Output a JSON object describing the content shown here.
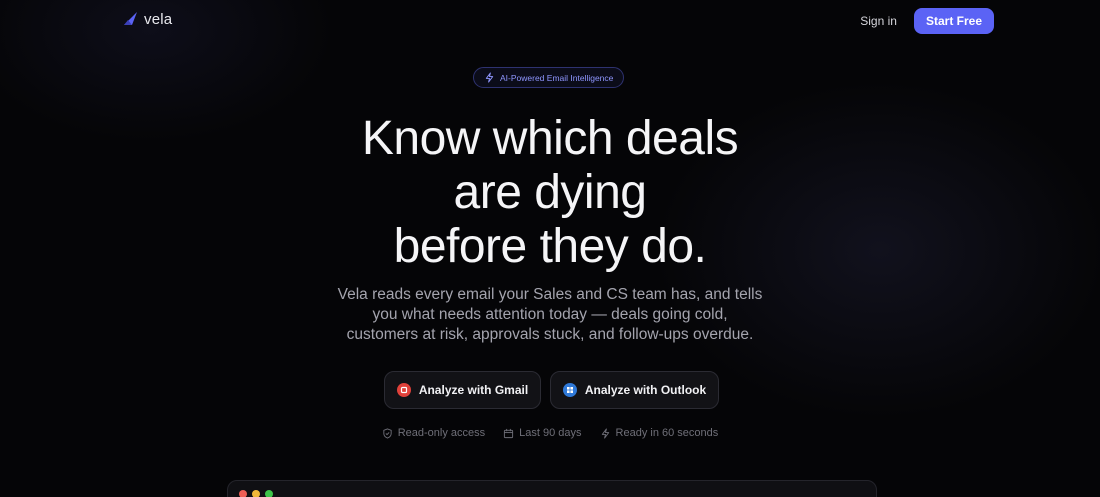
{
  "brand": {
    "name": "vela",
    "accent": "#5b63f5"
  },
  "nav": {
    "sign_in": "Sign in",
    "start_free": "Start Free"
  },
  "badge": {
    "icon": "lightning-icon",
    "text": "AI-Powered Email Intelligence"
  },
  "hero": {
    "headline_lines": [
      "Know which deals",
      "are dying",
      "before they do."
    ],
    "subtitle_lines": [
      "Vela reads every email your Sales and CS team has, and tells",
      "you what needs attention today — deals going cold,",
      "customers at risk, approvals stuck, and follow-ups overdue."
    ]
  },
  "cta": {
    "gmail": {
      "label": "Analyze with Gmail",
      "icon": "gmail-icon",
      "color": "#e0413a"
    },
    "outlook": {
      "label": "Analyze with Outlook",
      "icon": "outlook-icon",
      "color": "#2f79d8"
    }
  },
  "features": [
    {
      "icon": "shield-icon",
      "text": "Read-only access"
    },
    {
      "icon": "calendar-icon",
      "text": "Last 90 days"
    },
    {
      "icon": "lightning-icon",
      "text": "Ready in 60 seconds"
    }
  ],
  "preview": {
    "window_dots": [
      "#ee5e55",
      "#f1b83a",
      "#3ec54a"
    ]
  }
}
